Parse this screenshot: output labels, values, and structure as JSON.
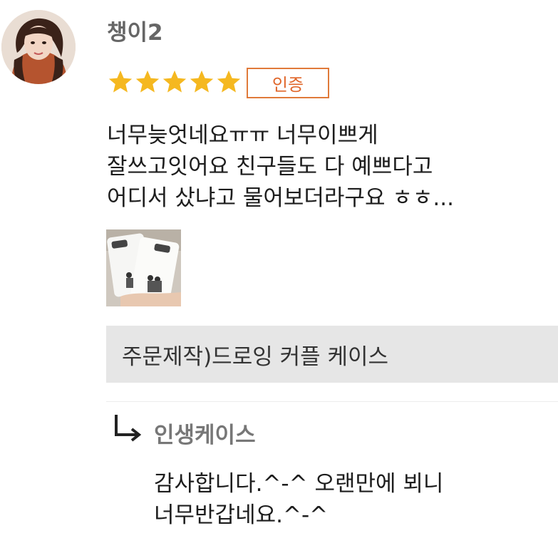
{
  "review": {
    "username": "챙이2",
    "rating": 5,
    "rating_max": 5,
    "badge_label": "인증",
    "text_lines": [
      "너무늦엇네요ㅠㅠ 너무이쁘게",
      "잘쓰고잇어요 친구들도 다 예쁘다고",
      "어디서 샀냐고 물어보더라구요 ㅎㅎ..."
    ],
    "product_name": "주문제작)드로잉 커플 케이스"
  },
  "reply": {
    "seller_name": "인생케이스",
    "text_lines": [
      "감사합니다.^-^ 오랜만에 뵈니",
      "너무반갑네요.^-^"
    ]
  },
  "colors": {
    "star": "#f5b820",
    "badge": "#e0662a",
    "product_bg": "#e6e6e6"
  }
}
